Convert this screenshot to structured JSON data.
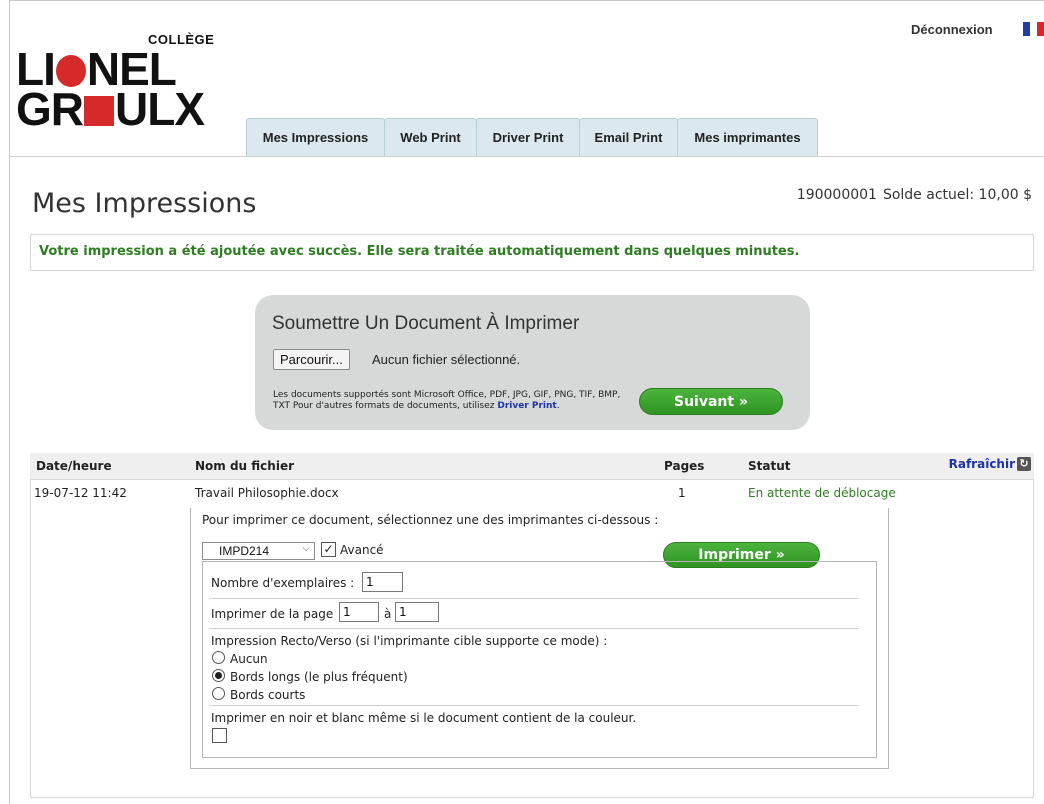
{
  "header": {
    "logo": {
      "top": "COLLÈGE",
      "line1": [
        "LI",
        "NEL"
      ],
      "line2": [
        "GR",
        "ULX"
      ]
    },
    "logout": "Déconnexion",
    "flag_colors": [
      "#1e3fa8",
      "#ffffff",
      "#e1222a"
    ],
    "tabs": [
      "Mes Impressions",
      "Web Print",
      "Driver Print",
      "Email Print",
      "Mes imprimantes"
    ]
  },
  "main": {
    "title": "Mes Impressions",
    "account": "190000001",
    "balance": "Solde actuel: 10,00 $",
    "success_message": "Votre impression a été ajoutée avec succès. Elle sera traitée automatiquement dans quelques minutes."
  },
  "submit": {
    "title": "Soumettre Un Document À Imprimer",
    "browse_label": "Parcourir...",
    "no_file": "Aucun fichier sélectionné.",
    "supported_text": "Les documents supportés sont Microsoft Office, PDF, JPG, GIF, PNG, TIF, BMP, TXT Pour d'autres formats de documents, utilisez",
    "driver_link": "Driver Print",
    "next_label": "Suivant »"
  },
  "jobs": {
    "headers": {
      "date": "Date/heure",
      "file": "Nom du fichier",
      "pages": "Pages",
      "status": "Statut",
      "refresh": "Rafraîchir"
    },
    "row": {
      "date": "19-07-12 11:42",
      "file": "Travail Philosophie.docx",
      "pages": "1",
      "status": "En attente de déblocage"
    }
  },
  "print_options": {
    "instruction": "Pour imprimer ce document, sélectionnez une des imprimantes ci-dessous :",
    "printer": "IMPD214",
    "advanced_label": "Avancé",
    "advanced_checked": true,
    "print_label": "Imprimer »",
    "copies_label": "Nombre d'exemplaires :",
    "copies_value": "1",
    "pages_label": "Imprimer de la page",
    "page_from": "1",
    "page_to_label": "à",
    "page_to": "1",
    "duplex_label": "Impression Recto/Verso (si l'imprimante cible supporte ce mode) :",
    "duplex_options": [
      "Aucun",
      "Bords longs (le plus fréquent)",
      "Bords courts"
    ],
    "duplex_selected": "Bords longs (le plus fréquent)",
    "bw_label": "Imprimer en noir et blanc même si le document contient de la couleur.",
    "bw_checked": false
  }
}
